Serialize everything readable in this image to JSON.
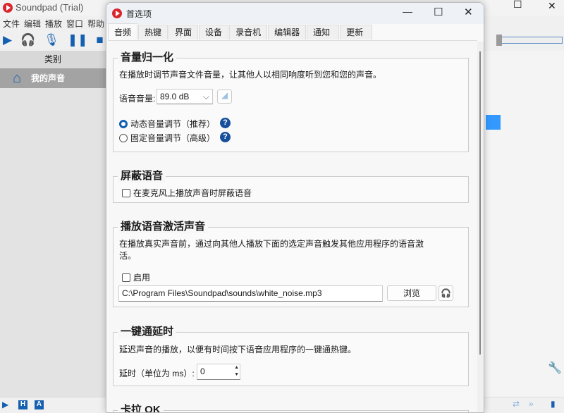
{
  "app": {
    "title": "Soundpad (Trial)",
    "menu": [
      "文件",
      "编辑",
      "播放",
      "窗口",
      "帮助"
    ],
    "category_header": "类别",
    "category_selected": "我的声音",
    "window_controls": {
      "minimize": "—",
      "maximize": "☐",
      "close": "✕"
    }
  },
  "dialog": {
    "title": "首选项",
    "tabs": [
      "音频",
      "热键",
      "界面",
      "设备",
      "录音机",
      "编辑器",
      "通知",
      "更新"
    ],
    "active_tab": "音频",
    "normalize": {
      "title": "音量归一化",
      "desc": "在播放时调节声音文件音量，让其他人以相同响度听到您和您的声音。",
      "volume_label": "语音音量:",
      "volume_value": "89.0 dB",
      "radio_dynamic": "动态音量调节（推荐）",
      "radio_fixed": "固定音量调节（高级）",
      "selected": "dynamic"
    },
    "mute": {
      "title": "屏蔽语音",
      "checkbox": "在麦克风上播放声音时屏蔽语音",
      "checked": false
    },
    "activation": {
      "title": "播放语音激活声音",
      "desc1": "在播放真实声音前，通过向其他人播放下面的选定声音触发其他应用程序的语音激",
      "desc2": "活。",
      "enable": "启用",
      "checked": false,
      "path": "C:\\Program Files\\Soundpad\\sounds\\white_noise.mp3",
      "browse": "浏览"
    },
    "ptt": {
      "title": "一键通延时",
      "desc": "延迟声音的播放，以便有时间按下语音应用程序的一键通热键。",
      "delay_label": "延时（单位为 ms）:",
      "delay_value": "0"
    },
    "karaoke": {
      "title": "卡拉 OK"
    }
  },
  "colors": {
    "accent": "#1560b0",
    "logo": "#d9262c"
  }
}
